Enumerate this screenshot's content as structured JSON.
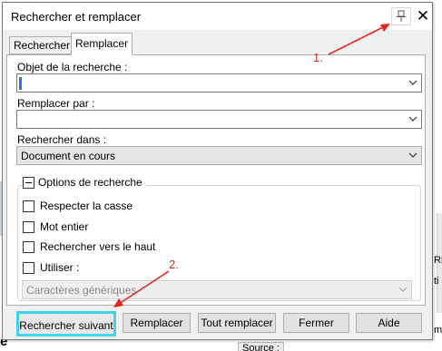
{
  "dialog": {
    "title": "Rechercher et remplacer",
    "pin_icon": "pin-icon",
    "close_glyph": "✕"
  },
  "tabs": [
    {
      "label": "Rechercher",
      "active": false
    },
    {
      "label": "Remplacer",
      "active": true
    }
  ],
  "find": {
    "label": "Objet de la recherche :",
    "value": ""
  },
  "replace": {
    "label": "Remplacer par :",
    "value": ""
  },
  "search_in": {
    "label": "Rechercher dans :",
    "selected": "Document en cours"
  },
  "options": {
    "header": "Options de recherche",
    "items": [
      {
        "label": "Respecter la casse",
        "checked": false
      },
      {
        "label": "Mot entier",
        "checked": false
      },
      {
        "label": "Rechercher vers le haut",
        "checked": false
      },
      {
        "label": "Utiliser :",
        "checked": false
      }
    ],
    "wildcard_select": "Caractères génériques"
  },
  "buttons": {
    "find_next": "Rechercher suivant",
    "replace": "Remplacer",
    "replace_all": "Tout remplacer",
    "close": "Fermer",
    "help": "Aide"
  },
  "annotations": {
    "one": "1.",
    "two": "2.",
    "color": "#e2251b",
    "highlight": "#3fd4ec"
  },
  "background": {
    "frag_e": "e",
    "frag_source": "Source :",
    "frag_ri": "Ri",
    "frag_ti": "ti",
    "frag_mi": "mi"
  }
}
